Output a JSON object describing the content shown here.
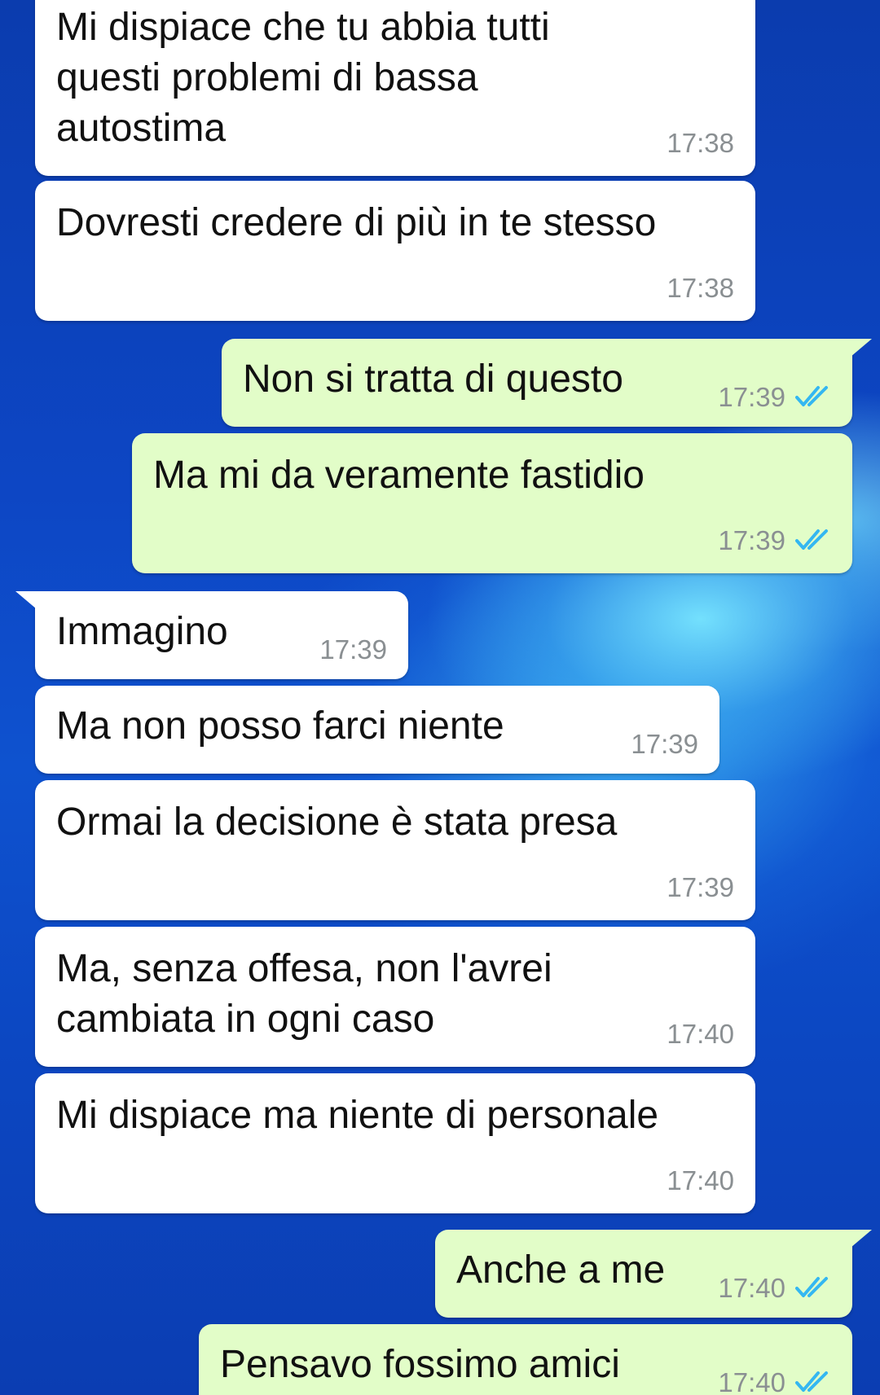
{
  "conversation": {
    "messages": [
      {
        "direction": "incoming",
        "lines": [
          "Mi dispiace che tu abbia tutti",
          "questi problemi di bassa",
          "autostima"
        ],
        "time": "17:38"
      },
      {
        "direction": "incoming",
        "lines": [
          "Dovresti credere di più in te stesso"
        ],
        "time": "17:38"
      },
      {
        "direction": "outgoing",
        "lines": [
          "Non si tratta di questo"
        ],
        "time": "17:39",
        "status": "read"
      },
      {
        "direction": "outgoing",
        "lines": [
          "Ma mi da veramente fastidio"
        ],
        "time": "17:39",
        "status": "read"
      },
      {
        "direction": "incoming",
        "lines": [
          "Immagino"
        ],
        "time": "17:39"
      },
      {
        "direction": "incoming",
        "lines": [
          "Ma non posso farci niente"
        ],
        "time": "17:39"
      },
      {
        "direction": "incoming",
        "lines": [
          "Ormai la decisione è stata presa"
        ],
        "time": "17:39"
      },
      {
        "direction": "incoming",
        "lines": [
          "Ma, senza offesa, non l'avrei",
          "cambiata in ogni caso"
        ],
        "time": "17:40"
      },
      {
        "direction": "incoming",
        "lines": [
          "Mi dispiace ma niente di personale"
        ],
        "time": "17:40"
      },
      {
        "direction": "outgoing",
        "lines": [
          "Anche a me"
        ],
        "time": "17:40",
        "status": "read"
      },
      {
        "direction": "outgoing",
        "lines": [
          "Pensavo fossimo amici"
        ],
        "time": "17:40",
        "status": "read"
      }
    ]
  },
  "icons": {
    "read_receipt": "double-check-icon"
  },
  "colors": {
    "incoming_bubble": "#ffffff",
    "outgoing_bubble": "#e2fdc8",
    "timestamp": "#8a8f92",
    "read_tick": "#34b7f1",
    "wallpaper": "#0d46c4"
  }
}
